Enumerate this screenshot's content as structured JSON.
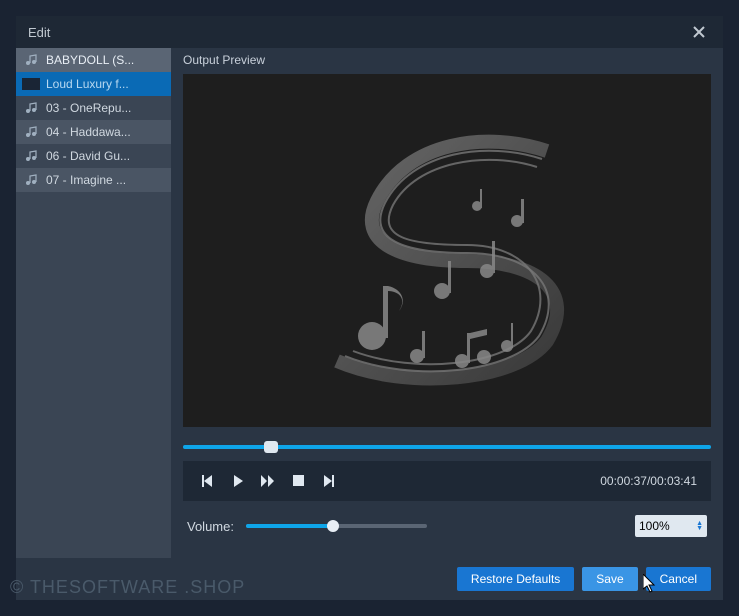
{
  "title": "Edit",
  "preview_label": "Output Preview",
  "tracks": [
    {
      "label": "BABYDOLL (S...",
      "state": "header",
      "icon": "music"
    },
    {
      "label": "Loud Luxury f...",
      "state": "selected",
      "icon": "thumb"
    },
    {
      "label": "03 - OneRepu...",
      "state": "normal",
      "icon": "music"
    },
    {
      "label": "04 - Haddawa...",
      "state": "alt",
      "icon": "music"
    },
    {
      "label": "06 - David Gu...",
      "state": "normal",
      "icon": "music"
    },
    {
      "label": "07 - Imagine ...",
      "state": "alt",
      "icon": "music"
    }
  ],
  "playback": {
    "current": "00:00:37",
    "total": "00:03:41",
    "seek_pct": 16.7
  },
  "volume": {
    "label": "Volume:",
    "pct": 48,
    "select_value": "100%"
  },
  "buttons": {
    "restore": "Restore Defaults",
    "save": "Save",
    "cancel": "Cancel"
  },
  "watermark": "© THESOFTWARE .SHOP"
}
